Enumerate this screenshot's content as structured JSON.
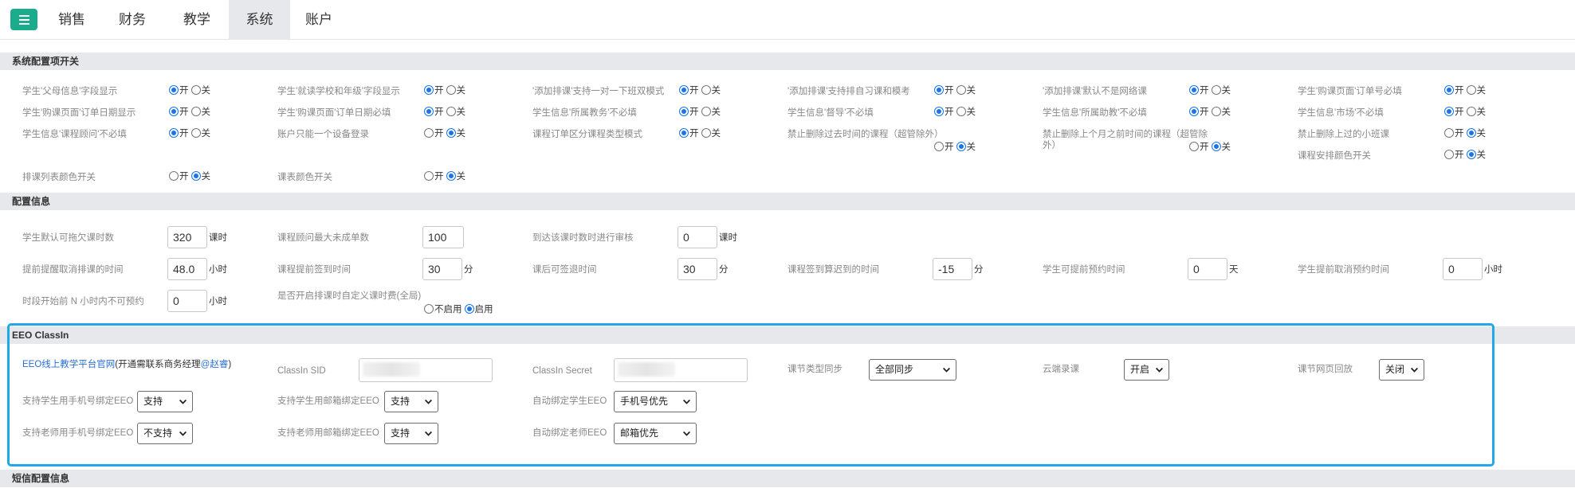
{
  "nav": {
    "tabs": [
      {
        "label": "销售"
      },
      {
        "label": "财务"
      },
      {
        "label": "教学"
      },
      {
        "label": "系统"
      },
      {
        "label": "账户"
      }
    ],
    "active": "系统"
  },
  "radio_labels": {
    "on": "开",
    "off": "关",
    "disable": "不启用",
    "enable": "启用"
  },
  "switches": {
    "title": "系统配置项开关",
    "items": [
      {
        "label": "学生'父母信息'字段显示",
        "value": "on"
      },
      {
        "label": "学生'就读学校和年级'字段显示",
        "value": "on"
      },
      {
        "label": "'添加排课'支持一对一下班双模式",
        "value": "on"
      },
      {
        "label": "'添加排课'支持排自习课和模考",
        "value": "on"
      },
      {
        "label": "'添加排课'默认不是网络课",
        "value": "on"
      },
      {
        "label": "学生'购课页面'订单号必填",
        "value": "on"
      },
      {
        "label": "学生'购课页面'订单日期显示",
        "value": "on"
      },
      {
        "label": "学生'购课页面'订单日期必填",
        "value": "on"
      },
      {
        "label": "学生信息'所属教务'不必填",
        "value": "on"
      },
      {
        "label": "学生信息'督导'不必填",
        "value": "on"
      },
      {
        "label": "学生信息'所属助教'不必填",
        "value": "on"
      },
      {
        "label": "学生信息'市场'不必填",
        "value": "on"
      },
      {
        "label": "学生信息'课程顾问'不必填",
        "value": "on"
      },
      {
        "label": "账户只能一个设备登录",
        "value": "off"
      },
      {
        "label": "课程订单区分课程类型模式",
        "value": "on"
      },
      {
        "label": "禁止删除过去时间的课程（超管除外）",
        "value": "off"
      },
      {
        "label": "禁止删除上个月之前时间的课程（超管除外）",
        "value": "off"
      },
      {
        "label": "禁止删除上过的小班课",
        "value": "off"
      },
      {
        "label": "课程安排颜色开关",
        "value": "off"
      },
      {
        "label": "排课列表颜色开关",
        "value": "off"
      },
      {
        "label": "课表颜色开关",
        "value": "off"
      }
    ]
  },
  "config": {
    "title": "配置信息",
    "fields": [
      {
        "label": "学生默认可拖欠课时数",
        "value": "320",
        "unit": "课时"
      },
      {
        "label": "课程顾问最大未成单数",
        "value": "100",
        "unit": ""
      },
      {
        "label": "到达该课时数时进行审核",
        "value": "0",
        "unit": "课时"
      },
      {
        "label": "提前提醒取消排课的时间",
        "value": "48.0",
        "unit": "小时"
      },
      {
        "label": "课程提前签到时间",
        "value": "30",
        "unit": "分"
      },
      {
        "label": "课后可签退时间",
        "value": "30",
        "unit": "分"
      },
      {
        "label": "课程签到算迟到的时间",
        "value": "-15",
        "unit": "分"
      },
      {
        "label": "学生可提前预约时间",
        "value": "0",
        "unit": "天"
      },
      {
        "label": "学生提前取消预约时间",
        "value": "0",
        "unit": "小时"
      },
      {
        "label": "时段开始前 N 小时内不可预约",
        "value": "0",
        "unit": "小时"
      }
    ],
    "custom_fee": {
      "label": "是否开启排课时自定义课时费(全局)",
      "value": "enable"
    }
  },
  "eeo": {
    "title": "EEO ClassIn",
    "link_text": "EEO线上教学平台官网",
    "note_prefix": "(开通需联系商务经理",
    "contact": "@赵睿",
    "note_suffix": ")",
    "sid_label": "ClassIn SID",
    "secret_label": "ClassIn Secret",
    "selects": [
      {
        "label": "课节类型同步",
        "value": "全部同步"
      },
      {
        "label": "云端录课",
        "value": "开启"
      },
      {
        "label": "课节网页回放",
        "value": "关闭"
      },
      {
        "label": "支持学生用手机号绑定EEO",
        "value": "支持"
      },
      {
        "label": "支持学生用邮箱绑定EEO",
        "value": "支持"
      },
      {
        "label": "自动绑定学生EEO",
        "value": "手机号优先"
      },
      {
        "label": "支持老师用手机号绑定EEO",
        "value": "不支持"
      },
      {
        "label": "支持老师用邮箱绑定EEO",
        "value": "支持"
      },
      {
        "label": "自动绑定老师EEO",
        "value": "邮箱优先"
      }
    ]
  },
  "sms": {
    "title": "短信配置信息"
  },
  "colors": {
    "accent": "#1aac8c",
    "highlight_border": "#20a9e6",
    "link": "#2a6fd0",
    "radio": "#1a73e8"
  },
  "icons": {
    "menu": "hamburger-menu-icon",
    "select": "chevron-down-icon"
  }
}
